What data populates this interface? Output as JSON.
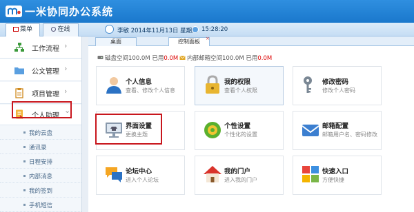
{
  "app": {
    "title": "一米协同办公系统"
  },
  "side_tabs": {
    "menu": "菜单",
    "online": "在线"
  },
  "user": {
    "info": "李敏 2014年11月13日 星期四",
    "time": "15:28:20"
  },
  "nav": [
    {
      "label": "工作流程",
      "icon": "workflow-icon",
      "chev": "›"
    },
    {
      "label": "公文管理",
      "icon": "folder-icon",
      "chev": "›"
    },
    {
      "label": "项目管理",
      "icon": "clipboard-icon",
      "chev": "›"
    },
    {
      "label": "个人助理",
      "icon": "notebook-icon",
      "chev": "⌄"
    }
  ],
  "subnav": [
    "我的云盘",
    "通讯录",
    "日程安排",
    "内部消息",
    "我的签到",
    "手机短信"
  ],
  "content_tabs": {
    "desktop": "桌面",
    "control": "控制面板",
    "close": "×"
  },
  "quota": {
    "disk_prefix": "磁盘空间100.0M 已用",
    "disk_used": "0.0M",
    "mail_prefix": "内部邮箱空间100.0M 已用",
    "mail_used": "0.0M"
  },
  "cards": [
    {
      "title": "个人信息",
      "desc": "查看、修改个人信息",
      "icon": "person-icon"
    },
    {
      "title": "我的权限",
      "desc": "查看个人权限",
      "icon": "lock-icon"
    },
    {
      "title": "修改密码",
      "desc": "修改个人密码",
      "icon": "key-icon"
    },
    {
      "title": "界面设置",
      "desc": "更换主题",
      "icon": "monitor-icon"
    },
    {
      "title": "个性设置",
      "desc": "个性化的设置",
      "icon": "gear-icon"
    },
    {
      "title": "邮箱配置",
      "desc": "邮箱用户名、密码修改",
      "icon": "mail-icon"
    },
    {
      "title": "论坛中心",
      "desc": "进入个人论坛",
      "icon": "forum-icon"
    },
    {
      "title": "我的门户",
      "desc": "进入我的门户",
      "icon": "home-icon"
    },
    {
      "title": "快速入口",
      "desc": "方便快捷",
      "icon": "tiles-icon"
    }
  ],
  "colors": {
    "header": "#1f80d6",
    "highlight": "#c8161d",
    "quota_used": "#dd0000"
  }
}
